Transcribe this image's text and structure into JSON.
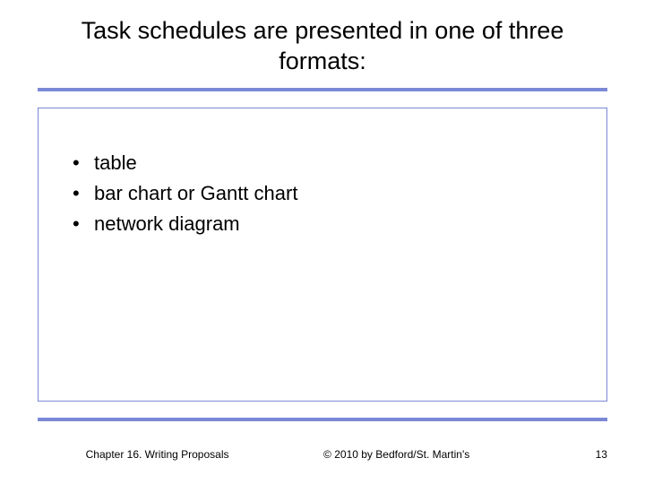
{
  "title": "Task schedules are presented in one of three formats:",
  "bullets": [
    "table",
    "bar chart or Gantt chart",
    "network diagram"
  ],
  "footer": {
    "chapter": "Chapter 16. Writing Proposals",
    "copyright": "© 2010 by Bedford/St. Martin's",
    "page": "13"
  }
}
